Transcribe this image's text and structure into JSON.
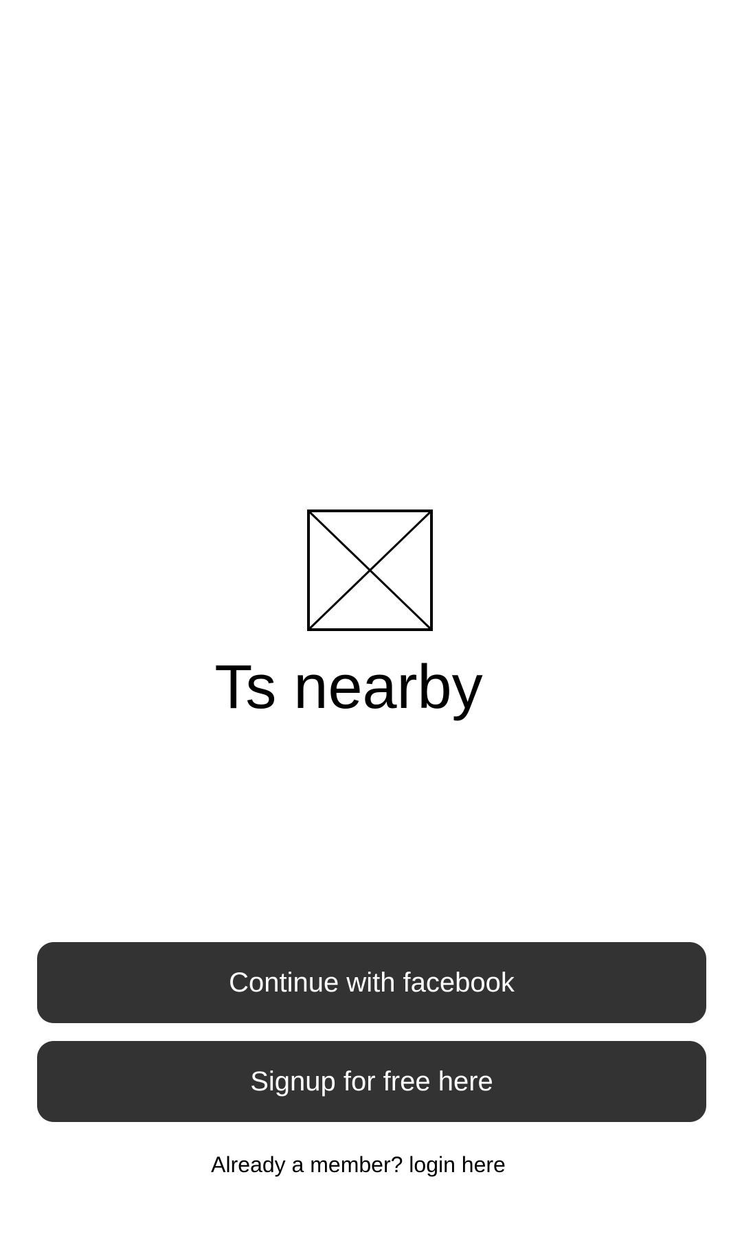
{
  "app": {
    "title": "Ts nearby",
    "logo_icon": "image-placeholder-icon"
  },
  "actions": {
    "facebook_label": "Continue with facebook",
    "signup_label": "Signup for free here",
    "login_prompt": "Already a member? login here"
  },
  "colors": {
    "background": "#ffffff",
    "button_bg": "#333333",
    "button_text": "#ffffff",
    "text": "#000000"
  }
}
